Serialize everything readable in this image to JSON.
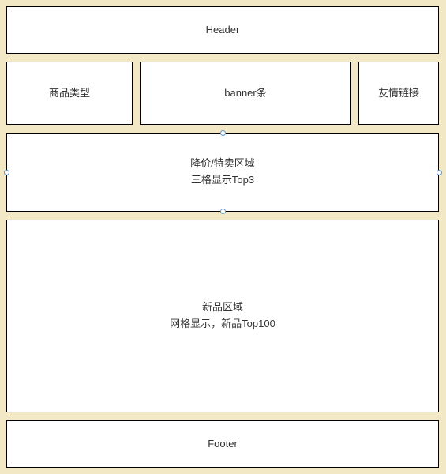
{
  "header": {
    "label": "Header"
  },
  "row2": {
    "category": {
      "label": "商品类型"
    },
    "banner": {
      "label": "banner条"
    },
    "links": {
      "label": "友情链接"
    }
  },
  "saleSection": {
    "line1": "降价/特卖区域",
    "line2": "三格显示Top3"
  },
  "newSection": {
    "line1": "新品区域",
    "line2": "网格显示，新品Top100"
  },
  "footer": {
    "label": "Footer"
  }
}
